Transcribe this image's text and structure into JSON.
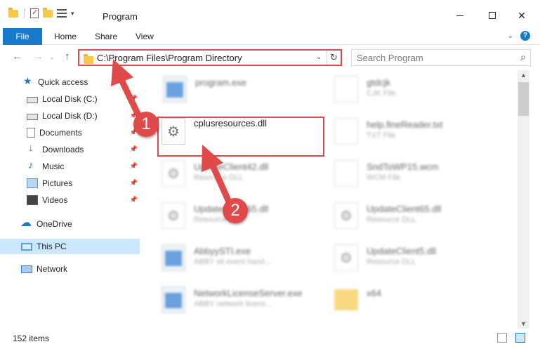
{
  "window": {
    "title": "Program",
    "controls": {
      "minimize": "",
      "maximize": "",
      "close": "✕"
    }
  },
  "ribbon": {
    "tabs": [
      "File",
      "Home",
      "Share",
      "View"
    ],
    "help": "?",
    "collapse": "⌄"
  },
  "address": {
    "path": "C:\\Program Files\\Program Directory",
    "dropdown": "⌄",
    "refresh": "↻"
  },
  "search": {
    "placeholder": "Search Program",
    "icon": "⌕"
  },
  "nav_buttons": {
    "back": "←",
    "forward": "→",
    "recent": "⌄",
    "up": "↑"
  },
  "sidebar": {
    "items": [
      {
        "label": "Quick access",
        "icon": "star-icon"
      },
      {
        "label": "Local Disk (C:)",
        "icon": "drive-icon",
        "pinned": true
      },
      {
        "label": "Local Disk (D:)",
        "icon": "drive-icon",
        "pinned": true
      },
      {
        "label": "Documents",
        "icon": "documents-icon",
        "pinned": true
      },
      {
        "label": "Downloads",
        "icon": "downloads-icon",
        "pinned": true
      },
      {
        "label": "Music",
        "icon": "music-icon",
        "pinned": true
      },
      {
        "label": "Pictures",
        "icon": "pictures-icon",
        "pinned": true
      },
      {
        "label": "Videos",
        "icon": "videos-icon",
        "pinned": true
      },
      {
        "label": "OneDrive",
        "icon": "onedrive-icon"
      },
      {
        "label": "This PC",
        "icon": "this-pc-icon",
        "selected": true
      },
      {
        "label": "Network",
        "icon": "network-icon"
      }
    ]
  },
  "files": [
    {
      "name": "program.exe",
      "type": ""
    },
    {
      "name": "gtdcjk",
      "type": "CJK File"
    },
    {
      "name": "cplusresources.dll",
      "type": ""
    },
    {
      "name": "help.fineReader.txt",
      "type": "TXT File"
    },
    {
      "name": "UpdateClient42.dll",
      "type": "Resource DLL"
    },
    {
      "name": "SndToWP15.wcm",
      "type": "WCM File"
    },
    {
      "name": "UpdateClient65.dll",
      "type": "Resource DLL"
    },
    {
      "name": "UpdateClient65.dll",
      "type": "Resource DLL"
    },
    {
      "name": "AbbyySTI.exe",
      "type": "ABBY sti event hand..."
    },
    {
      "name": "UpdateClient5.dll",
      "type": "Resource DLL"
    },
    {
      "name": "NetworkLicenseServer.exe",
      "type": "ABBY network licens..."
    },
    {
      "name": "x64",
      "type": ""
    }
  ],
  "status": {
    "item_count": "152 items"
  },
  "annotations": {
    "badge_1": "1",
    "badge_2": "2"
  },
  "colors": {
    "accent": "#1979ca",
    "highlight": "#e04a4a",
    "selected": "#cce8ff"
  }
}
